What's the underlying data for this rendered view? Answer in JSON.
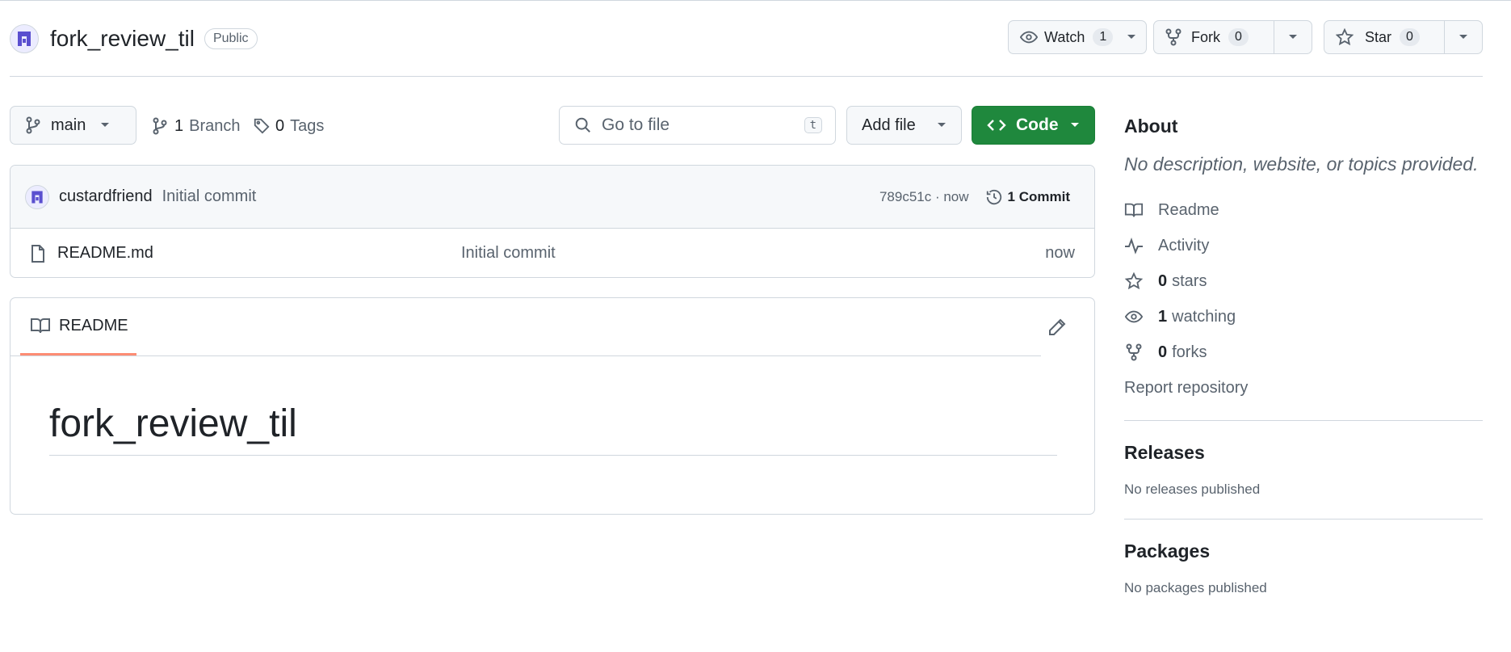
{
  "repo": {
    "name": "fork_review_til",
    "visibility": "Public"
  },
  "actions": {
    "watch": {
      "label": "Watch",
      "count": "1"
    },
    "fork": {
      "label": "Fork",
      "count": "0"
    },
    "star": {
      "label": "Star",
      "count": "0"
    }
  },
  "toolbar": {
    "branch": "main",
    "branches_count": "1",
    "branches_label": "Branch",
    "tags_count": "0",
    "tags_label": "Tags",
    "search_placeholder": "Go to file",
    "search_shortcut": "t",
    "add_file": "Add file",
    "code": "Code"
  },
  "latest_commit": {
    "author": "custardfriend",
    "message": "Initial commit",
    "hash_time": "789c51c · now",
    "commits": "1 Commit"
  },
  "files": [
    {
      "name": "README.md",
      "message": "Initial commit",
      "time": "now"
    }
  ],
  "readme": {
    "tab": "README",
    "heading": "fork_review_til"
  },
  "about": {
    "title": "About",
    "description": "No description, website, or topics provided.",
    "links": {
      "readme": "Readme",
      "activity": "Activity",
      "stars_count": "0",
      "stars_label": "stars",
      "watching_count": "1",
      "watching_label": "watching",
      "forks_count": "0",
      "forks_label": "forks",
      "report": "Report repository"
    }
  },
  "releases": {
    "title": "Releases",
    "empty": "No releases published"
  },
  "packages": {
    "title": "Packages",
    "empty": "No packages published"
  },
  "colors": {
    "code_button": "#1f883d",
    "tab_underline": "#fd8c73",
    "muted_text": "#59636e",
    "border": "#d0d7de"
  }
}
